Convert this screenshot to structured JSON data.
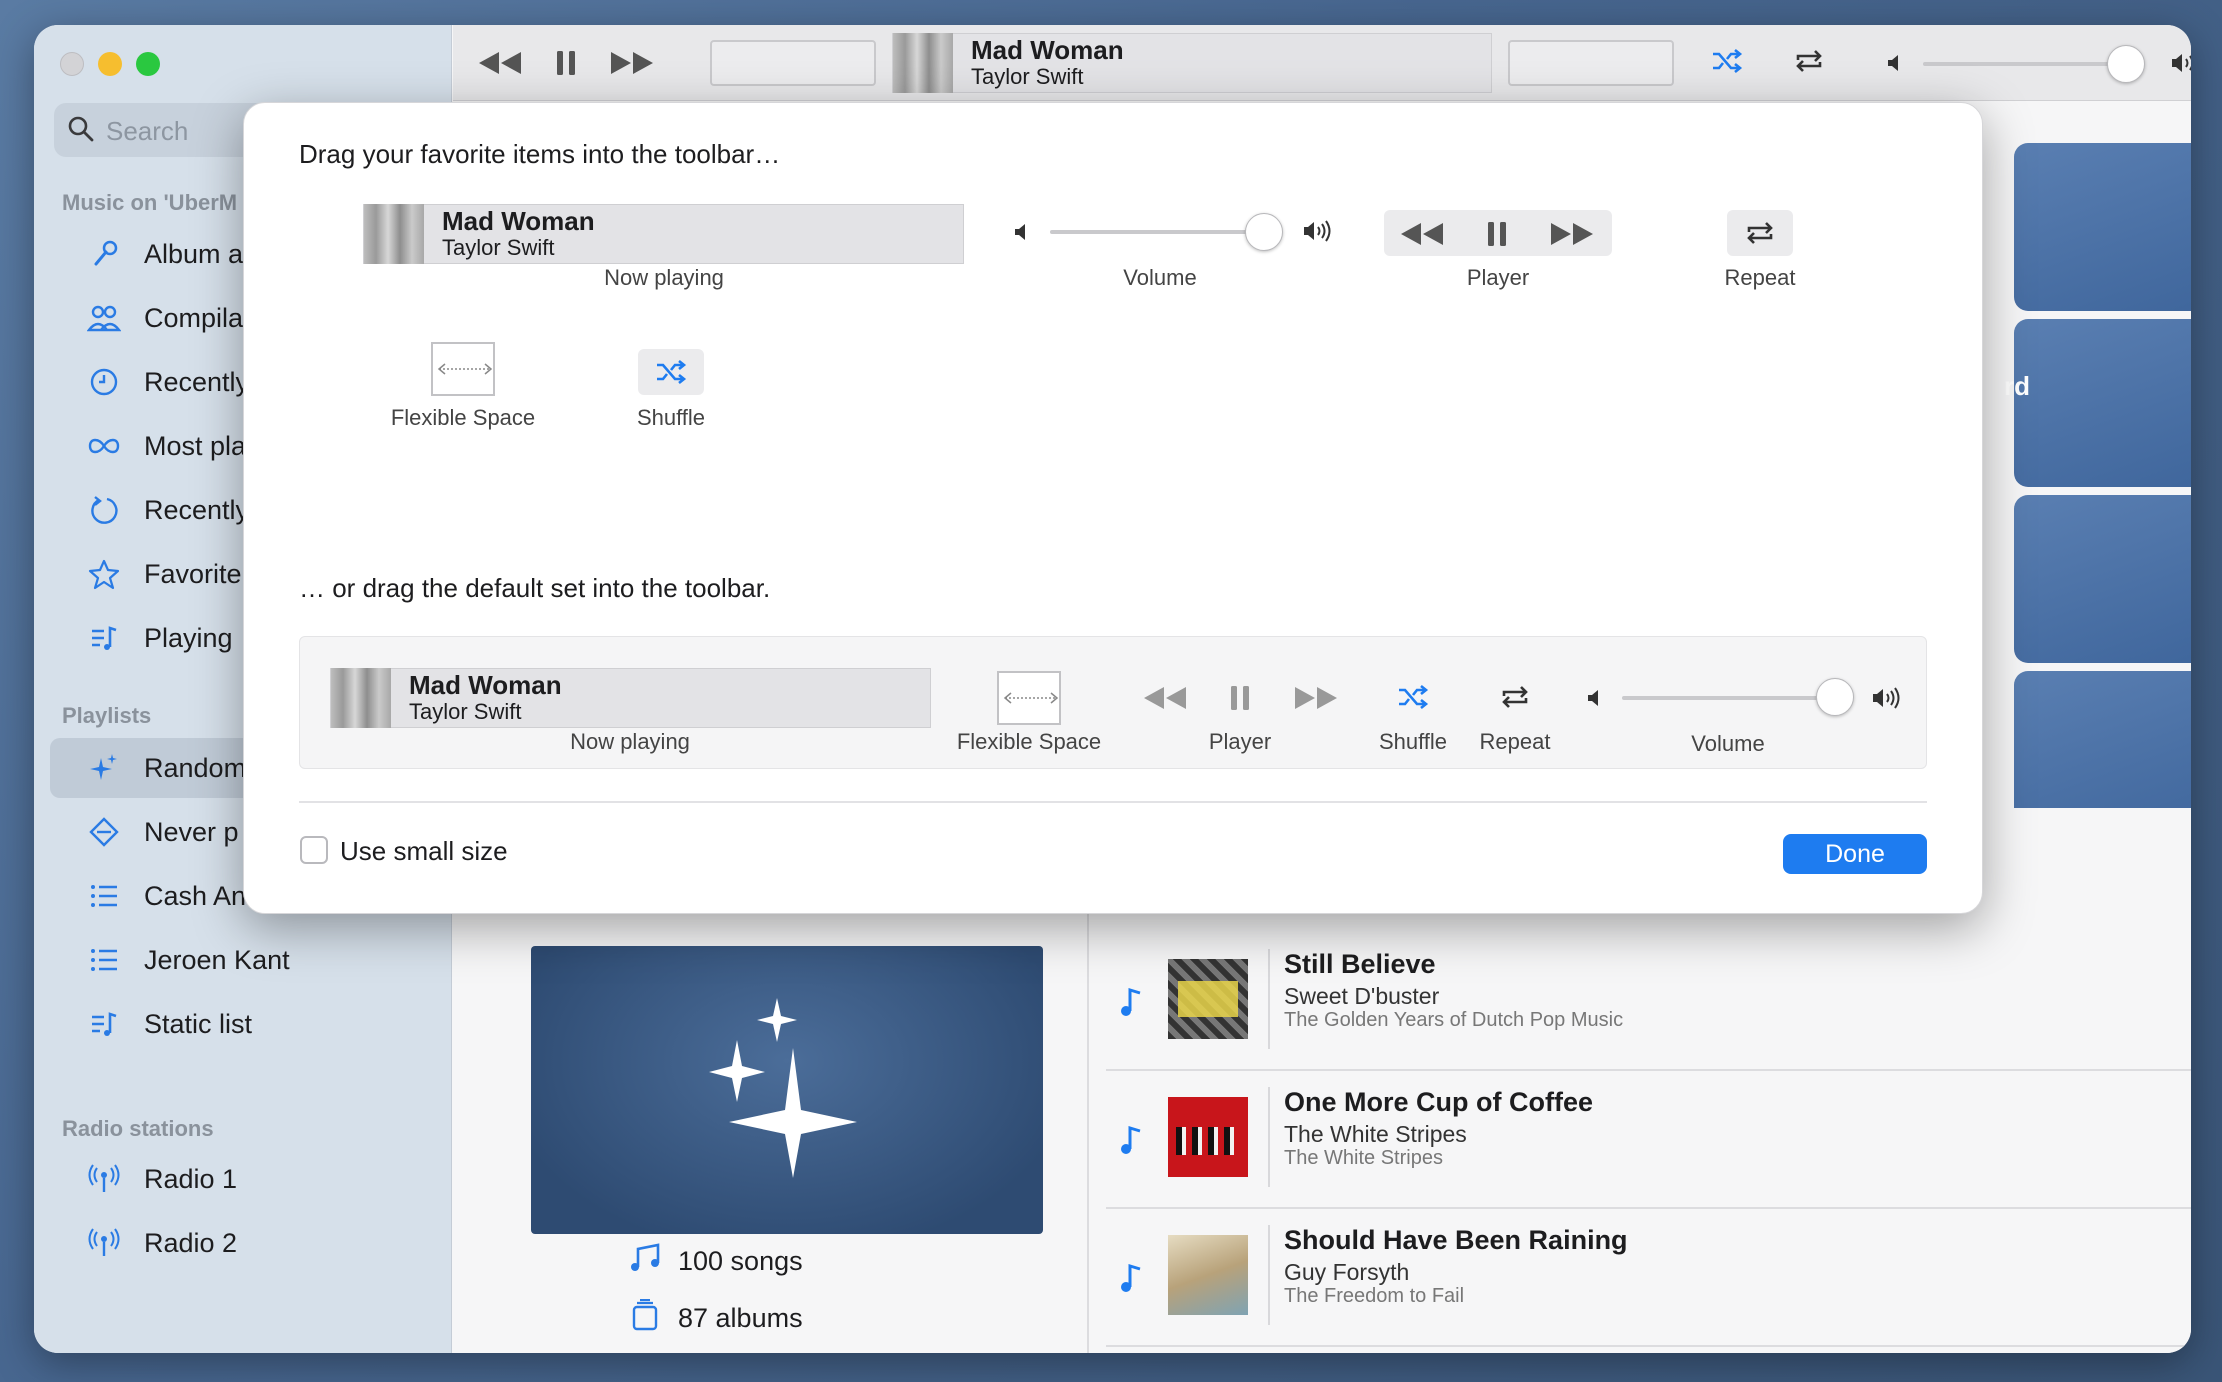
{
  "window": {
    "traffic_lights": {
      "close": "#d3d3d6",
      "minimize": "#f6be2f",
      "maximize": "#2ac840"
    }
  },
  "sidebar": {
    "search_placeholder": "Search",
    "library_section": "Music on 'UberM",
    "library_items": [
      {
        "label": "Album a",
        "icon": "microphone-icon"
      },
      {
        "label": "Compila",
        "icon": "people-icon"
      },
      {
        "label": "Recently",
        "icon": "clock-icon"
      },
      {
        "label": "Most pla",
        "icon": "infinity-icon"
      },
      {
        "label": "Recently",
        "icon": "refresh-icon"
      },
      {
        "label": "Favorite",
        "icon": "star-icon"
      },
      {
        "label": "Playing",
        "icon": "music-list-icon"
      }
    ],
    "playlists_section": "Playlists",
    "playlists": [
      {
        "label": "Random",
        "icon": "sparkle-icon",
        "selected": true
      },
      {
        "label": "Never p",
        "icon": "diamond-icon"
      },
      {
        "label": "Cash An",
        "icon": "list-icon"
      },
      {
        "label": "Jeroen Kant",
        "icon": "list-icon"
      },
      {
        "label": "Static list",
        "icon": "music-list-icon"
      }
    ],
    "radio_section": "Radio stations",
    "radios": [
      {
        "label": "Radio 1",
        "icon": "antenna-icon"
      },
      {
        "label": "Radio 2",
        "icon": "antenna-icon"
      }
    ]
  },
  "toolbar": {
    "now_playing": {
      "title": "Mad Woman",
      "artist": "Taylor Swift"
    },
    "volume_level": 1.0
  },
  "cards": {
    "partial_text": "rd"
  },
  "playlist_detail": {
    "songs_count": "100 songs",
    "albums_count": "87 albums"
  },
  "songs": [
    {
      "title": "Still Believe",
      "artist": "Sweet D'buster",
      "album": "The Golden Years of Dutch Pop Music"
    },
    {
      "title": "One More Cup of Coffee",
      "artist": "The White Stripes",
      "album": "The White Stripes"
    },
    {
      "title": "Should Have Been Raining",
      "artist": "Guy Forsyth",
      "album": "The Freedom to Fail"
    }
  ],
  "dialog": {
    "heading": "Drag your favorite items into the toolbar…",
    "items": {
      "now_playing": {
        "title": "Mad Woman",
        "artist": "Taylor Swift",
        "caption": "Now playing"
      },
      "volume": "Volume",
      "player": "Player",
      "repeat": "Repeat",
      "flexible_space": "Flexible Space",
      "shuffle": "Shuffle"
    },
    "default_heading": "… or drag the default set into the toolbar.",
    "default_set": {
      "now_playing": {
        "title": "Mad Woman",
        "artist": "Taylor Swift",
        "caption": "Now playing"
      },
      "flexible_space": "Flexible Space",
      "player": "Player",
      "shuffle": "Shuffle",
      "repeat": "Repeat",
      "volume": "Volume"
    },
    "small_size_label": "Use small size",
    "small_size_checked": false,
    "done_label": "Done"
  },
  "colors": {
    "accent": "#1e7cf0",
    "sidebar_icon": "#2a7be4"
  }
}
